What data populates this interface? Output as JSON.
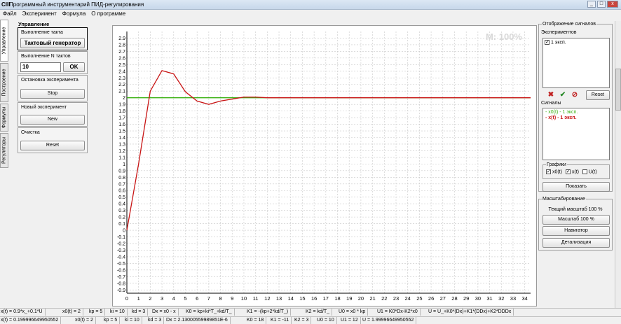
{
  "window": {
    "title": "Программный инструментарий ПИД-регулирования",
    "icon_text": "СIII",
    "minimize": "_",
    "maximize": "□",
    "close": "x"
  },
  "menu": [
    "Файл",
    "Эксперимент",
    "Формула",
    "О программе"
  ],
  "left_tabs": [
    "Управление",
    "Построение",
    "Формулы",
    "Регуляторы"
  ],
  "control": {
    "title": "Управление",
    "step_label": "Выполнение такта",
    "step_button": "Тактовый генератор",
    "n_steps_label": "Выполнение N тактов",
    "n_steps_value": "10",
    "ok_button": "OK",
    "stop_label": "Остановка эксперимента",
    "stop_button": "Stop",
    "new_label": "Новый эксперимент",
    "new_button": "New",
    "clear_label": "Очистка",
    "reset_button": "Reset"
  },
  "chart_overlay": "M: 100%",
  "chart_data": {
    "type": "line",
    "x_ticks": [
      0,
      1,
      2,
      3,
      4,
      5,
      6,
      7,
      8,
      9,
      10,
      11,
      12,
      13,
      14,
      15,
      16,
      17,
      18,
      19,
      20,
      21,
      22,
      23,
      24,
      25,
      26,
      27,
      28,
      29,
      30,
      31,
      32,
      33,
      34
    ],
    "y_ticks": [
      -0.9,
      -0.8,
      -0.7,
      -0.6,
      -0.5,
      -0.4,
      -0.3,
      -0.2,
      -0.1,
      0,
      0.1,
      0.2,
      0.3,
      0.4,
      0.5,
      0.6,
      0.7,
      0.8,
      0.9,
      1.0,
      1.1,
      1.2,
      1.3,
      1.4,
      1.5,
      1.6,
      1.7,
      1.8,
      1.9,
      2.0,
      2.1,
      2.2,
      2.3,
      2.4,
      2.5,
      2.6,
      2.7,
      2.8,
      2.9
    ],
    "xlim": [
      0,
      34.5
    ],
    "ylim": [
      -0.95,
      3.0
    ],
    "grid": true,
    "series": [
      {
        "name": "x0(t) - 1 эксп.",
        "color": "#39b010",
        "x": [
          0,
          34.5
        ],
        "y": [
          2.0,
          2.0
        ]
      },
      {
        "name": "x(t) - 1 эксп.",
        "color": "#c81414",
        "x": [
          0,
          1,
          2,
          3,
          4,
          5,
          6,
          7,
          8,
          9,
          10,
          11,
          12,
          34.5
        ],
        "y": [
          0,
          1.0,
          2.1,
          2.41,
          2.36,
          2.09,
          1.95,
          1.9,
          1.95,
          1.98,
          2.01,
          2.01,
          2.0,
          2.0
        ]
      }
    ]
  },
  "signals_panel": {
    "title": "Отображение сигналов",
    "experiments_label": "Экспериментов",
    "experiment_item": "1 эксп.",
    "reset_button": "Reset",
    "signals_label": "Сигналы",
    "signal_items": [
      "- x0(t) - 1 эксп.",
      "- x(t) - 1 эксп."
    ],
    "signal_colors": [
      "#39b010",
      "#c81414"
    ],
    "graphs_label": "Графики",
    "graph_x0": "x0(t)",
    "graph_x": "x(t)",
    "graph_u": "U(t)",
    "show_button": "Показать"
  },
  "scale_panel": {
    "title": "Масштабирование",
    "current_scale": "Текщий масштаб 100 %",
    "scale_button": "Масштаб 100 %",
    "navigator_button": "Навигатор",
    "detail_button": "Детализация"
  },
  "status_row1": [
    "x(t) = 0.9*x_+0.1*U",
    "x0(t) = 2",
    "kp = 5",
    "ki = 10",
    "kd = 3",
    "Dx = x0 - x",
    "K0 = kp+ki*T_+kd/T_",
    "K1 = -(kp+2*kd/T_)",
    "K2 = kd/T_",
    "U0 = x0 * kp",
    "U1 = K0*Dx-K2*x0",
    "U = U_+K0*(Dx)+K1*(DDx)+K2*DDDx"
  ],
  "status_row2": [
    "x(t) = 0.199996649950552",
    "x0(t) = 2",
    "kp = 5",
    "ki = 10",
    "kd = 3",
    "Dx = 2.13000559989851E-6",
    "K0 = 18",
    "K1 = -11",
    "K2 = 3",
    "U0 = 10",
    "U1 = 12",
    "U = 1.99996649950552"
  ]
}
